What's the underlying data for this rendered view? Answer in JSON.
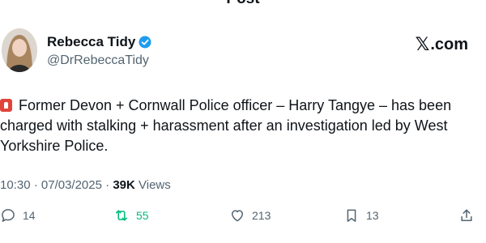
{
  "header": {
    "title": "Post"
  },
  "author": {
    "name": "Rebecca Tidy",
    "handle": "@DrRebeccaTidy",
    "verified": true
  },
  "brand": {
    "x_glyph": "𝕏",
    "domain": ".com"
  },
  "tweet": {
    "emoji_icon": "rotating-light-icon",
    "text": "Former Devon + Cornwall Police officer – Harry Tangye – has been charged with stalking + harassment after an investigation led by West Yorkshire Police."
  },
  "meta": {
    "time": "10:30",
    "separator": " · ",
    "date": "07/03/2025",
    "views_count": "39K",
    "views_label": "Views"
  },
  "actions": {
    "replies": "14",
    "reposts": "55",
    "likes": "213",
    "bookmarks": "13"
  },
  "colors": {
    "repost_green": "#00ba7c",
    "verified_blue": "#1d9bf0",
    "secondary_text": "#536471"
  }
}
